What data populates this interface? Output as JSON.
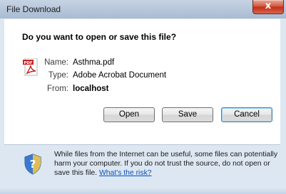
{
  "window": {
    "title": "File Download",
    "close_symbol": "x"
  },
  "dialog": {
    "question": "Do you want to open or save this file?",
    "file_icon": "pdf-icon",
    "fields": [
      {
        "label": "Name:",
        "value": "Asthma.pdf"
      },
      {
        "label": "Type:",
        "value": "Adobe Acrobat Document"
      },
      {
        "label": "From:",
        "value": "localhost"
      }
    ],
    "buttons": {
      "open": "Open",
      "save": "Save",
      "cancel": "Cancel"
    }
  },
  "warning": {
    "icon": "shield-question-icon",
    "text": "While files from the Internet can be useful, some files can potentially harm your computer. If you do not trust the source, do not open or save this file.",
    "link_text": "What's the risk?"
  },
  "colors": {
    "pdf_red": "#c8201f",
    "shield_blue": "#2f6fc4",
    "link_blue": "#0b4fbf"
  }
}
